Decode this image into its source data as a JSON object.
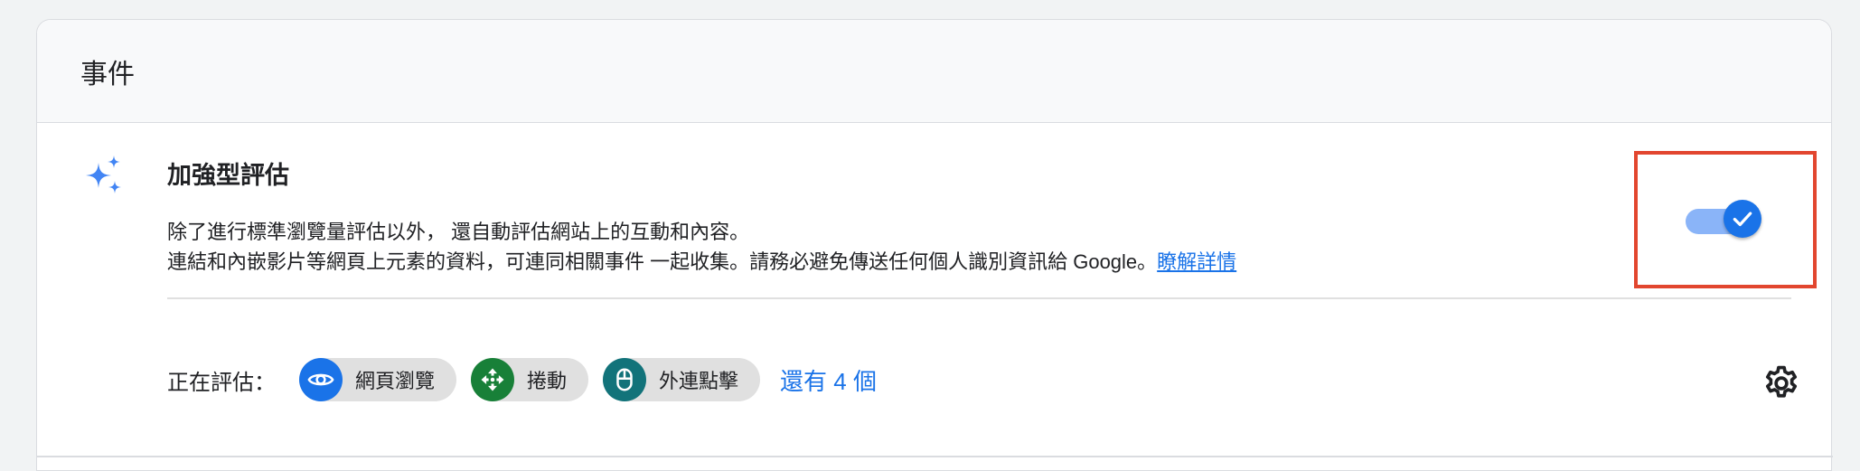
{
  "header": {
    "title": "事件"
  },
  "enhanced": {
    "title": "加強型評估",
    "desc_line1": "除了進行標準瀏覽量評估以外， 還自動評估網站上的互動和內容。",
    "desc_line2": "連結和內嵌影片等網頁上元素的資料，可連同相關事件 一起收集。請務必避免傳送任何個人識別資訊給 Google。",
    "learn_more": "瞭解詳情",
    "toggle_on": true
  },
  "measuring": {
    "label": "正在評估：",
    "chips": [
      {
        "label": "網頁瀏覽",
        "icon": "eye-icon",
        "color": "#1a73e8"
      },
      {
        "label": "捲動",
        "icon": "scroll-arrows-icon",
        "color": "#188038"
      },
      {
        "label": "外連點擊",
        "icon": "mouse-icon",
        "color": "#12737a"
      }
    ],
    "more": "還有 4 個"
  },
  "colors": {
    "accent": "#1a73e8",
    "highlight": "#e2462f"
  }
}
